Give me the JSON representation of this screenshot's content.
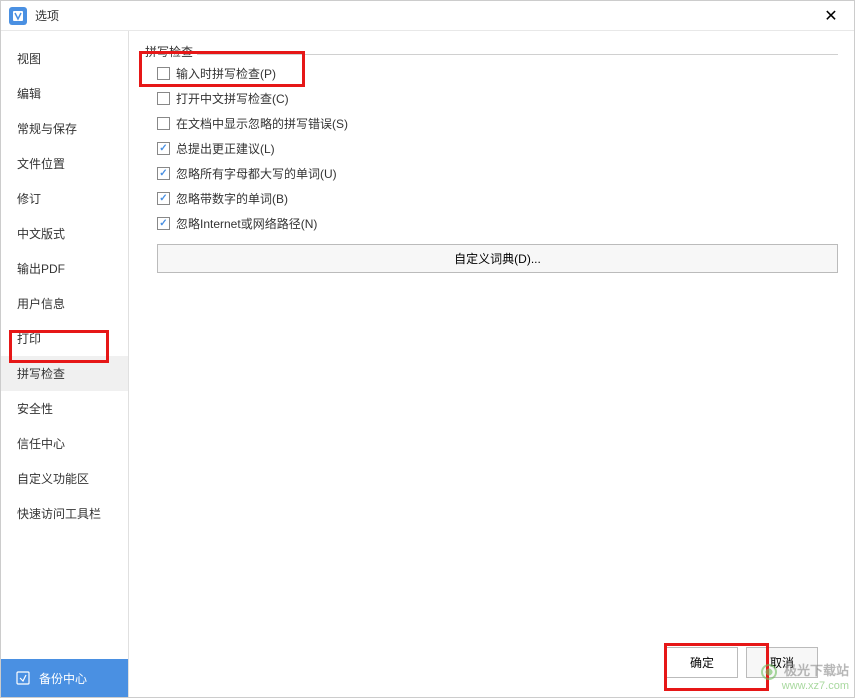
{
  "title": "选项",
  "sidebar": {
    "items": [
      {
        "label": "视图",
        "selected": false
      },
      {
        "label": "编辑",
        "selected": false
      },
      {
        "label": "常规与保存",
        "selected": false
      },
      {
        "label": "文件位置",
        "selected": false
      },
      {
        "label": "修订",
        "selected": false
      },
      {
        "label": "中文版式",
        "selected": false
      },
      {
        "label": "输出PDF",
        "selected": false
      },
      {
        "label": "用户信息",
        "selected": false
      },
      {
        "label": "打印",
        "selected": false
      },
      {
        "label": "拼写检查",
        "selected": true
      },
      {
        "label": "安全性",
        "selected": false
      },
      {
        "label": "信任中心",
        "selected": false
      },
      {
        "label": "自定义功能区",
        "selected": false
      },
      {
        "label": "快速访问工具栏",
        "selected": false
      }
    ],
    "backup_label": "备份中心"
  },
  "section_title": "拼写检查",
  "options": [
    {
      "label": "输入时拼写检查(P)",
      "checked": false
    },
    {
      "label": "打开中文拼写检查(C)",
      "checked": false
    },
    {
      "label": "在文档中显示忽略的拼写错误(S)",
      "checked": false
    },
    {
      "label": "总提出更正建议(L)",
      "checked": true
    },
    {
      "label": "忽略所有字母都大写的单词(U)",
      "checked": true
    },
    {
      "label": "忽略带数字的单词(B)",
      "checked": true
    },
    {
      "label": "忽略Internet或网络路径(N)",
      "checked": true
    }
  ],
  "custom_dict_label": "自定义词典(D)...",
  "footer": {
    "ok": "确定",
    "cancel": "取消"
  },
  "watermark": {
    "line1": "极光下载站",
    "line2": "www.xz7.com"
  }
}
